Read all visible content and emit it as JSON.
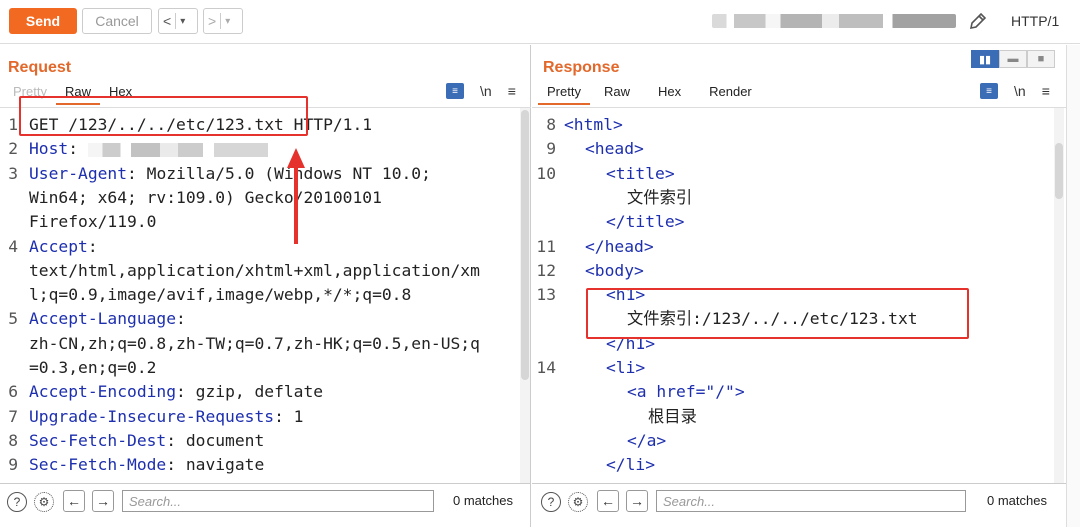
{
  "toolbar": {
    "send_label": "Send",
    "cancel_label": "Cancel",
    "prev_label": "<",
    "next_label": ">",
    "dropdown_label": "▾",
    "http_version": "HTTP/1"
  },
  "request": {
    "title": "Request",
    "tabs": [
      "Pretty",
      "Raw",
      "Hex"
    ],
    "active_tab": "Raw",
    "newline_toggle": "\\n",
    "menu": "≡",
    "lines": [
      {
        "n": "1",
        "text": "GET /123/../../etc/123.txt HTTP/1.1"
      },
      {
        "n": "2",
        "key": "Host",
        "sep": ": "
      },
      {
        "n": "3",
        "key": "User-Agent",
        "sep": ": ",
        "val": "Mozilla/5.0 (Windows NT 10.0;"
      },
      {
        "n": "",
        "text": "Win64; x64; rv:109.0) Gecko/20100101"
      },
      {
        "n": "",
        "text": "Firefox/119.0"
      },
      {
        "n": "4",
        "key": "Accept",
        "sep": ":"
      },
      {
        "n": "",
        "text": "text/html,application/xhtml+xml,application/xm"
      },
      {
        "n": "",
        "text": "l;q=0.9,image/avif,image/webp,*/*;q=0.8"
      },
      {
        "n": "5",
        "key": "Accept-Language",
        "sep": ":"
      },
      {
        "n": "",
        "text": "zh-CN,zh;q=0.8,zh-TW;q=0.7,zh-HK;q=0.5,en-US;q"
      },
      {
        "n": "",
        "text": "=0.3,en;q=0.2"
      },
      {
        "n": "6",
        "key": "Accept-Encoding",
        "sep": ": ",
        "val": "gzip, deflate"
      },
      {
        "n": "7",
        "key": "Upgrade-Insecure-Requests",
        "sep": ": ",
        "val": "1"
      },
      {
        "n": "8",
        "key": "Sec-Fetch-Dest",
        "sep": ": ",
        "val": "document"
      },
      {
        "n": "9",
        "key": "Sec-Fetch-Mode",
        "sep": ": ",
        "val": "navigate"
      }
    ],
    "search_placeholder": "Search...",
    "matches": "0 matches"
  },
  "response": {
    "title": "Response",
    "tabs": [
      "Pretty",
      "Raw",
      "Hex",
      "Render"
    ],
    "active_tab": "Pretty",
    "newline_toggle": "\\n",
    "menu": "≡",
    "lines": [
      {
        "n": "8",
        "indent": 0,
        "text": "<html>"
      },
      {
        "n": "9",
        "indent": 1,
        "text": "<head>"
      },
      {
        "n": "10",
        "indent": 2,
        "text": "<title>"
      },
      {
        "n": "",
        "indent": 3,
        "text": "文件索引",
        "plain": true
      },
      {
        "n": "",
        "indent": 2,
        "text": "</title>"
      },
      {
        "n": "11",
        "indent": 1,
        "text": "</head>"
      },
      {
        "n": "12",
        "indent": 1,
        "text": "<body>"
      },
      {
        "n": "13",
        "indent": 2,
        "text": "<h1>"
      },
      {
        "n": "",
        "indent": 3,
        "text": "文件索引:/123/../../etc/123.txt",
        "plain": true
      },
      {
        "n": "",
        "indent": 2,
        "text": "</h1>"
      },
      {
        "n": "14",
        "indent": 2,
        "text": "<li>"
      },
      {
        "n": "",
        "indent": 3,
        "text": "<a href=\"/\">"
      },
      {
        "n": "",
        "indent": 4,
        "text": "根目录",
        "plain": true
      },
      {
        "n": "",
        "indent": 3,
        "text": "</a>"
      },
      {
        "n": "",
        "indent": 2,
        "text": "</li>"
      }
    ],
    "search_placeholder": "Search...",
    "matches": "0 matches"
  },
  "colors": {
    "accent": "#f26a21",
    "keyword": "#1d2fae",
    "highlight_box": "#e5322d"
  }
}
